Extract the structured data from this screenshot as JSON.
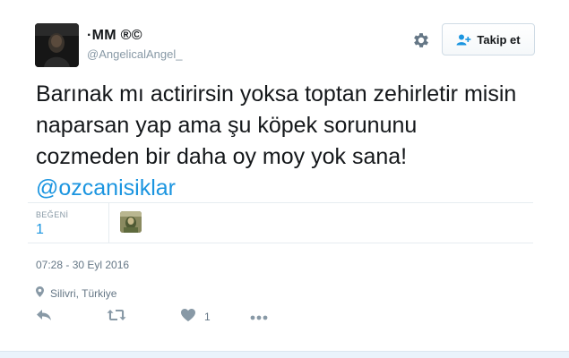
{
  "user": {
    "name": "·MM ®©",
    "handle": "@AngelicalAngel_"
  },
  "follow_button": {
    "label": "Takip et"
  },
  "tweet": {
    "text_lines": [
      "Barınak mı actirirsin yoksa toptan zehirletir misin",
      "naparsan yap ama şu köpek sorununu",
      "cozmeden bir daha oy moy yok sana!"
    ],
    "mention": "@ozcanisiklar"
  },
  "stats": {
    "likes_label": "BEĞENİ",
    "likes_count": "1"
  },
  "timestamp": "07:28 - 30 Eyl 2016",
  "location": "Silivri, Türkiye",
  "actions": {
    "like_count": "1"
  },
  "colors": {
    "link": "#1b95e0",
    "muted": "#8899a6",
    "text": "#14171a",
    "divider": "#e6ecf0"
  },
  "icons": [
    "gear-icon",
    "follow-person-plus-icon",
    "location-pin-icon",
    "reply-icon",
    "retweet-icon",
    "heart-icon",
    "more-icon"
  ]
}
